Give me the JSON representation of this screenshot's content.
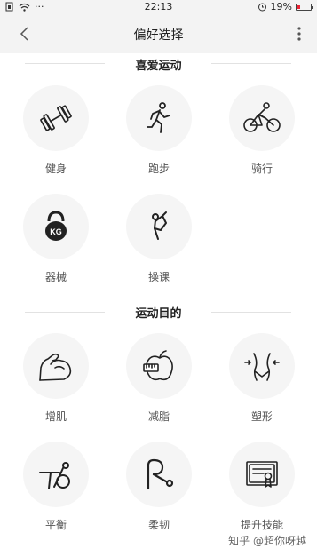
{
  "status_bar": {
    "dots": "···",
    "time": "22:13",
    "battery": "19%",
    "battery_level": 0.19
  },
  "header": {
    "title": "偏好选择"
  },
  "sections": [
    {
      "title": "喜爱运动"
    },
    {
      "title": "运动目的"
    }
  ],
  "items": [
    {
      "label": "健身",
      "icon": "dumbbell-icon"
    },
    {
      "label": "跑步",
      "icon": "running-icon"
    },
    {
      "label": "骑行",
      "icon": "cycling-icon"
    },
    {
      "label": "器械",
      "icon": "kettlebell-icon"
    },
    {
      "label": "操课",
      "icon": "stretching-icon"
    },
    {
      "label": "增肌",
      "icon": "muscle-arm-icon"
    },
    {
      "label": "减脂",
      "icon": "apple-tape-icon"
    },
    {
      "label": "塑形",
      "icon": "waist-icon"
    },
    {
      "label": "平衡",
      "icon": "balance-icon"
    },
    {
      "label": "柔韧",
      "icon": "flexibility-icon"
    },
    {
      "label": "提升技能",
      "icon": "certificate-icon"
    }
  ],
  "watermark": "知乎 @超你呀越"
}
